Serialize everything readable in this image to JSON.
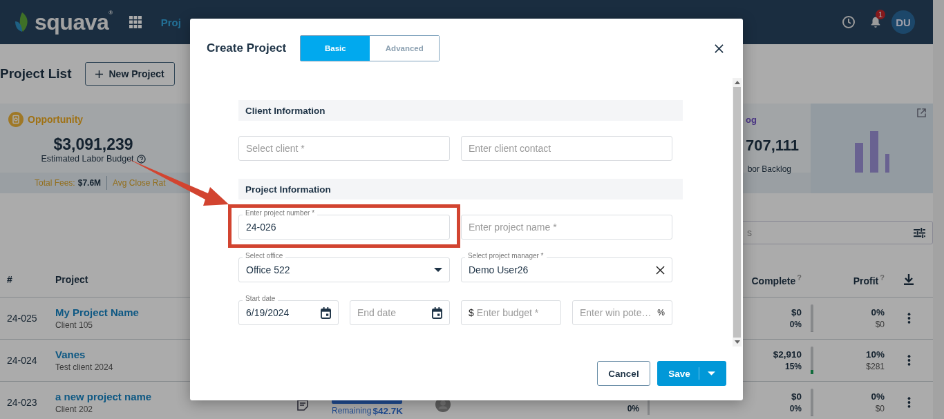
{
  "header": {
    "logo": "squava$^{®}$",
    "nav_item": "Proj",
    "notification_count": "1",
    "avatar": "DU"
  },
  "page": {
    "title": "Project List",
    "new_button": "New Project"
  },
  "opportunity_card": {
    "title": "Opportunity",
    "amount": "$3,091,239",
    "caption": "Estimated Labor Budget",
    "fees_label": "Total Fees:",
    "fees_value": "$7.6M",
    "close_rate_label": "Avg Close Rat"
  },
  "backlog_card": {
    "title": "og",
    "amount": "707,111",
    "caption": "bor Backlog"
  },
  "search": {
    "placeholder": "s"
  },
  "table": {
    "columns": [
      {
        "label": "#"
      },
      {
        "label": "Project"
      },
      {
        "label": "Complete",
        "help": "?"
      },
      {
        "label": "Profit",
        "help": "?"
      }
    ],
    "rows": [
      {
        "number": "24-025",
        "name": "My Project Name",
        "client": "Client 105",
        "complete_amount": "$0",
        "complete_pct": "0%",
        "level": 0,
        "profit_pct": "0%",
        "profit_amount": "$0"
      },
      {
        "number": "24-024",
        "name": "Vanes",
        "client": "Test client 2024",
        "complete_amount": "$2,910",
        "complete_pct": "15%",
        "level": 0.15,
        "profit_pct": "10%",
        "profit_amount": "$281"
      },
      {
        "number": "24-023",
        "name": "a new project name",
        "client": "Client 202",
        "remaining_label": "Remaining",
        "remaining_value": "$42.7K",
        "budget_pct": "0%",
        "complete_amount": "$0",
        "complete_pct": "0%",
        "level": 0,
        "profit_pct": "0%",
        "profit_amount": "$0"
      }
    ]
  },
  "modal": {
    "title": "Create Project",
    "tabs": [
      {
        "label": "Basic",
        "selected": true
      },
      {
        "label": "Advanced",
        "selected": false
      }
    ],
    "sections": [
      {
        "title": "Client Information",
        "rows": [
          [
            {
              "kind": "text",
              "placeholder": "Select client *"
            },
            {
              "kind": "text",
              "placeholder": "Enter client contact"
            }
          ]
        ]
      },
      {
        "title": "Project Information",
        "rows": [
          [
            {
              "kind": "text",
              "label": "Enter project number *",
              "value": "24-026",
              "highlighted": true
            },
            {
              "kind": "text",
              "placeholder": "Enter project name *"
            }
          ],
          [
            {
              "kind": "select",
              "label": "Select office",
              "value": "Office 522"
            },
            {
              "kind": "clearable",
              "label": "Select project manager *",
              "value": "Demo User26"
            }
          ],
          [
            {
              "kind": "date",
              "label": "Start date",
              "value": "6/19/2024"
            },
            {
              "kind": "date",
              "placeholder": "End date"
            },
            {
              "kind": "money",
              "prefix": "$",
              "placeholder": "Enter budget *"
            },
            {
              "kind": "percent",
              "placeholder": "Enter win pote…",
              "suffix": "%"
            }
          ]
        ]
      }
    ],
    "buttons": {
      "cancel": "Cancel",
      "save": "Save"
    }
  }
}
